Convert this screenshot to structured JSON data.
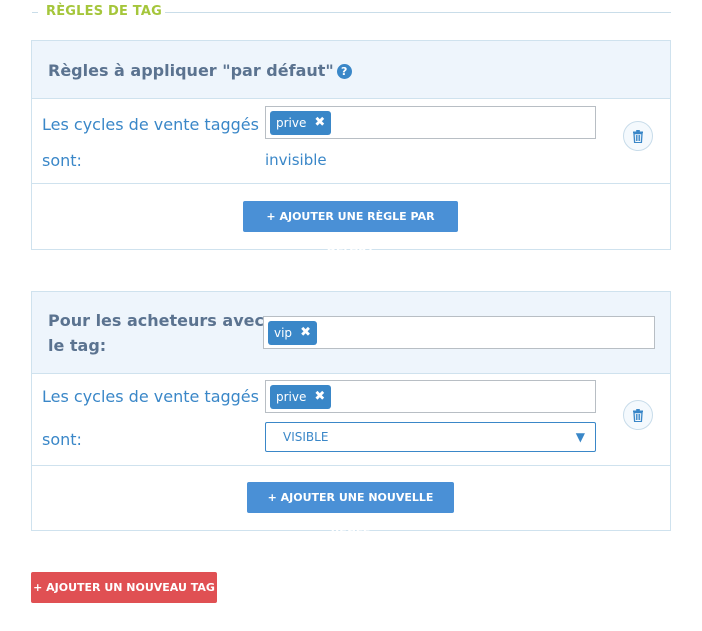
{
  "section": {
    "title": "RÈGLES DE TAG"
  },
  "default_rules": {
    "title": "Règles à appliquer \"par défaut\"",
    "help_icon": "question-circle-icon",
    "row": {
      "label_line1": "Les cycles de vente taggés",
      "label_line2": "sont:",
      "tag": "prive",
      "state": "invisible"
    },
    "add_button": "+ AJOUTER UNE RÈGLE PAR DÉFAUT"
  },
  "buyer_rules": {
    "title_line1": "Pour les acheteurs avec",
    "title_line2": "le tag:",
    "buyer_tag": "vip",
    "row": {
      "label_line1": "Les cycles de vente taggés",
      "label_line2": "sont:",
      "tag": "prive",
      "visibility_selected": "VISIBLE"
    },
    "add_button": "+ AJOUTER UNE NOUVELLE RÈGLE"
  },
  "add_tag_button": "+ AJOUTER UN NOUVEAU TAG",
  "colors": {
    "accent": "#3a87c8",
    "section_title": "#a5c63b",
    "danger": "#e05053",
    "panel_head": "#eef5fc"
  }
}
